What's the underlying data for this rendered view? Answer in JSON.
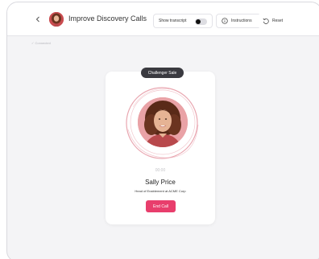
{
  "header": {
    "title": "Improve Discovery Calls",
    "back_icon": "chevron-left-icon",
    "transcript_label": "Show transcript",
    "transcript_on": false,
    "instructions_label": "Instructions",
    "instructions_icon": "info-circle-icon",
    "reset_label": "Reset",
    "reset_icon": "rotate-left-icon"
  },
  "status": {
    "label": "✓ Connected"
  },
  "call": {
    "mode": "Challenger Sale",
    "timer": "00:00",
    "name": "Sally Price",
    "role": "Head of Enablement at ACME Corp",
    "end_label": "End Call"
  },
  "colors": {
    "accent": "#e83e6c",
    "ring": "#e9a6b0",
    "badge": "#3a3a40"
  }
}
